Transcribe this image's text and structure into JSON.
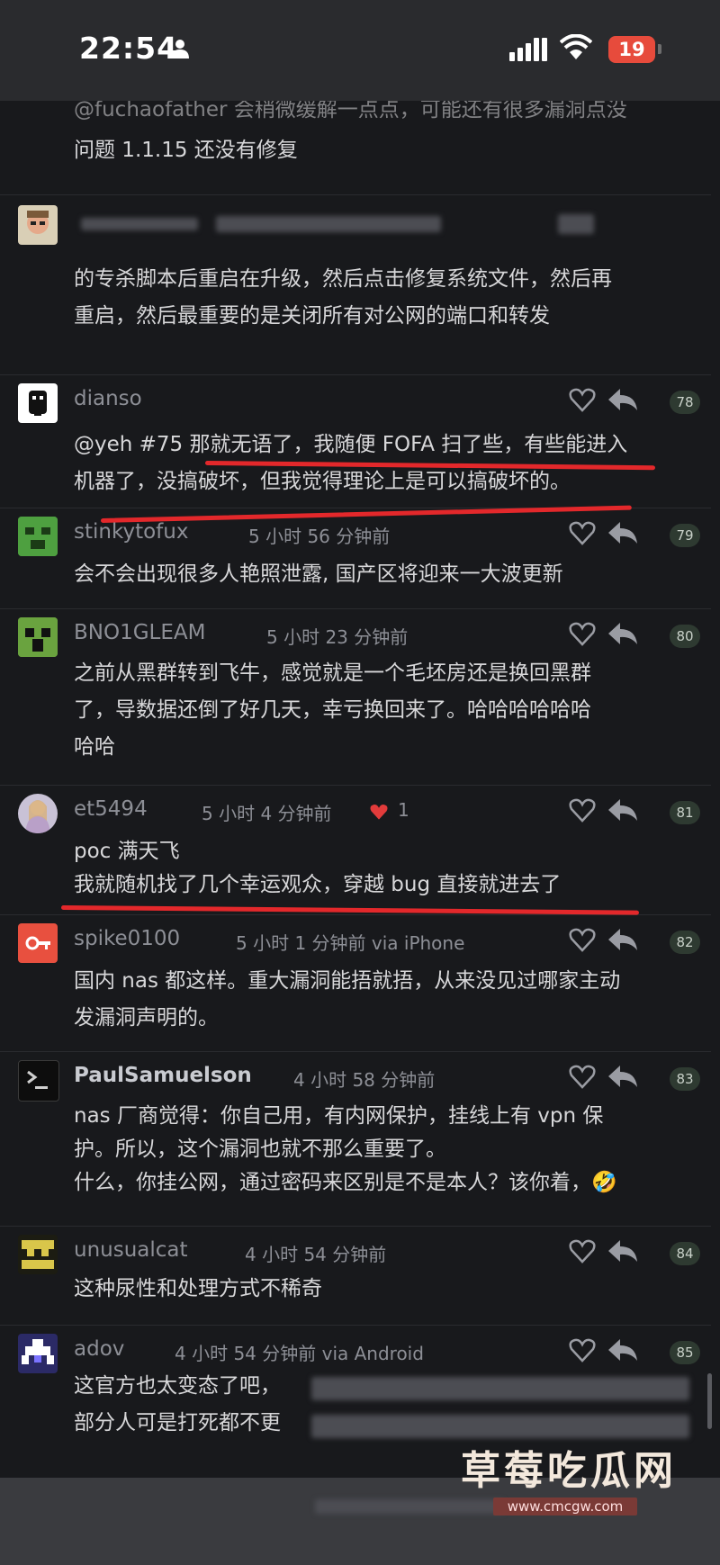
{
  "status_bar": {
    "time": "22:54",
    "battery": "19"
  },
  "comments": [
    {
      "id": "c0",
      "lines": [
        "@fuchaofather 会稍微缓解一点点，可能还有很多漏洞点没",
        "问题 1.1.15 还没有修复"
      ]
    },
    {
      "id": "c1",
      "lines": [
        "的专杀脚本后重启在升级，然后点击修复系统文件，然后再",
        "重启，然后最重要的是关闭所有对公网的端口和转发"
      ]
    },
    {
      "id": "c2",
      "username": "dianso",
      "time": "",
      "floor": "78",
      "lines": [
        "@yeh #75 那就无语了，我随便 FOFA 扫了些，有些能进入",
        "机器了，没搞破坏，但我觉得理论上是可以搞破坏的。"
      ]
    },
    {
      "id": "c3",
      "username": "stinkytofux",
      "time": "5 小时 56 分钟前",
      "floor": "79",
      "lines": [
        "会不会出现很多人艳照泄露, 国产区将迎来一大波更新"
      ]
    },
    {
      "id": "c4",
      "username": "BNO1GLEAM",
      "time": "5 小时 23 分钟前",
      "floor": "80",
      "lines": [
        "之前从黑群转到飞牛，感觉就是一个毛坯房还是换回黑群",
        "了，导数据还倒了好几天，幸亏换回来了。哈哈哈哈哈哈",
        "哈哈"
      ]
    },
    {
      "id": "c5",
      "username": "et5494",
      "time": "5 小时 4 分钟前",
      "likes": "1",
      "floor": "81",
      "lines": [
        "poc 满天飞",
        "我就随机找了几个幸运观众，穿越 bug 直接就进去了"
      ]
    },
    {
      "id": "c6",
      "username": "spike0100",
      "time": "5 小时 1 分钟前 via iPhone",
      "floor": "82",
      "lines": [
        "国内 nas 都这样。重大漏洞能捂就捂，从来没见过哪家主动",
        "发漏洞声明的。"
      ]
    },
    {
      "id": "c7",
      "username": "PaulSamuelson",
      "time": "4 小时 58 分钟前",
      "floor": "83",
      "lines": [
        "nas 厂商觉得：你自己用，有内网保护，挂线上有 vpn 保",
        "护。所以，这个漏洞也就不那么重要了。",
        "什么，你挂公网，通过密码来区别是不是本人？该你着，🤣"
      ]
    },
    {
      "id": "c8",
      "username": "unusualcat",
      "time": "4 小时 54 分钟前",
      "floor": "84",
      "lines": [
        "这种尿性和处理方式不稀奇"
      ]
    },
    {
      "id": "c9",
      "username": "adov",
      "time": "4 小时 54 分钟前 via Android",
      "floor": "85",
      "lines": [
        "这官方也太变态了吧，",
        "部分人可是打死都不更"
      ]
    }
  ],
  "watermark": {
    "title": "草莓吃瓜网",
    "url": "www.cmcgw.com"
  },
  "colors": {
    "background": "#18191c",
    "annotation": "#e3282b",
    "floor_badge": "#2e3a31"
  }
}
